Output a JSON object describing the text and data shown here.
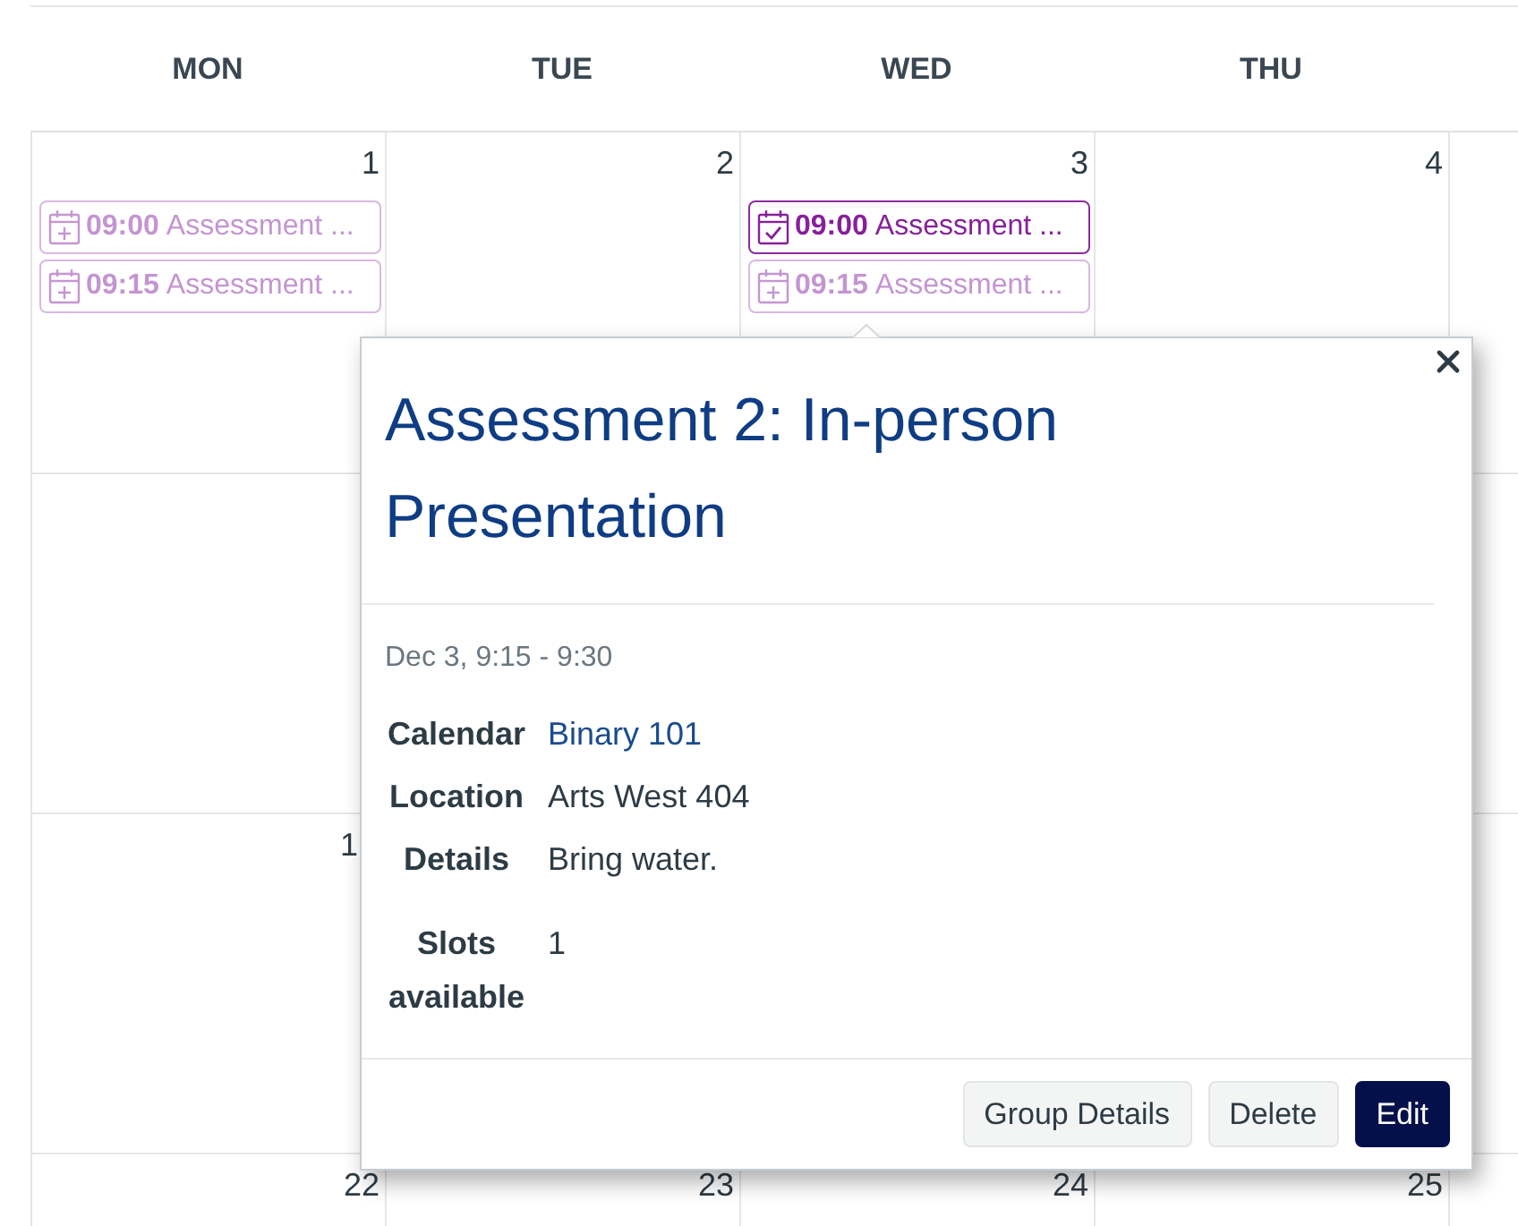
{
  "weekdays": [
    "MON",
    "TUE",
    "WED",
    "THU"
  ],
  "weeks": [
    {
      "days": [
        {
          "number": "1",
          "events": [
            {
              "time": "09:00",
              "title": "Assessment ...",
              "reserved": false
            },
            {
              "time": "09:15",
              "title": "Assessment ...",
              "reserved": false
            }
          ]
        },
        {
          "number": "2"
        },
        {
          "number": "3",
          "events": [
            {
              "time": "09:00",
              "title": "Assessment ...",
              "reserved": true
            },
            {
              "time": "09:15",
              "title": "Assessment ...",
              "reserved": false
            }
          ]
        },
        {
          "number": "4"
        }
      ]
    },
    {
      "days": [
        {
          "number": "1",
          "clipped": true
        }
      ]
    },
    {
      "days": [
        {
          "number": "22"
        },
        {
          "number": "23"
        },
        {
          "number": "24"
        },
        {
          "number": "25"
        }
      ]
    }
  ],
  "popover": {
    "title": "Assessment 2: In-person Presentation",
    "when": "Dec 3, 9:15 - 9:30",
    "details": [
      {
        "label": "Calendar",
        "value": "Binary 101",
        "kind": "link"
      },
      {
        "label": "Location",
        "value": "Arts West 404",
        "kind": "text"
      },
      {
        "label": "Details",
        "value": "Bring water.",
        "kind": "text"
      },
      {
        "label": "Slots available",
        "value": "1",
        "kind": "text"
      }
    ],
    "buttons": [
      {
        "label": "Group Details",
        "kind": "secondary"
      },
      {
        "label": "Delete",
        "kind": "secondary"
      },
      {
        "label": "Edit",
        "kind": "primary"
      }
    ]
  }
}
